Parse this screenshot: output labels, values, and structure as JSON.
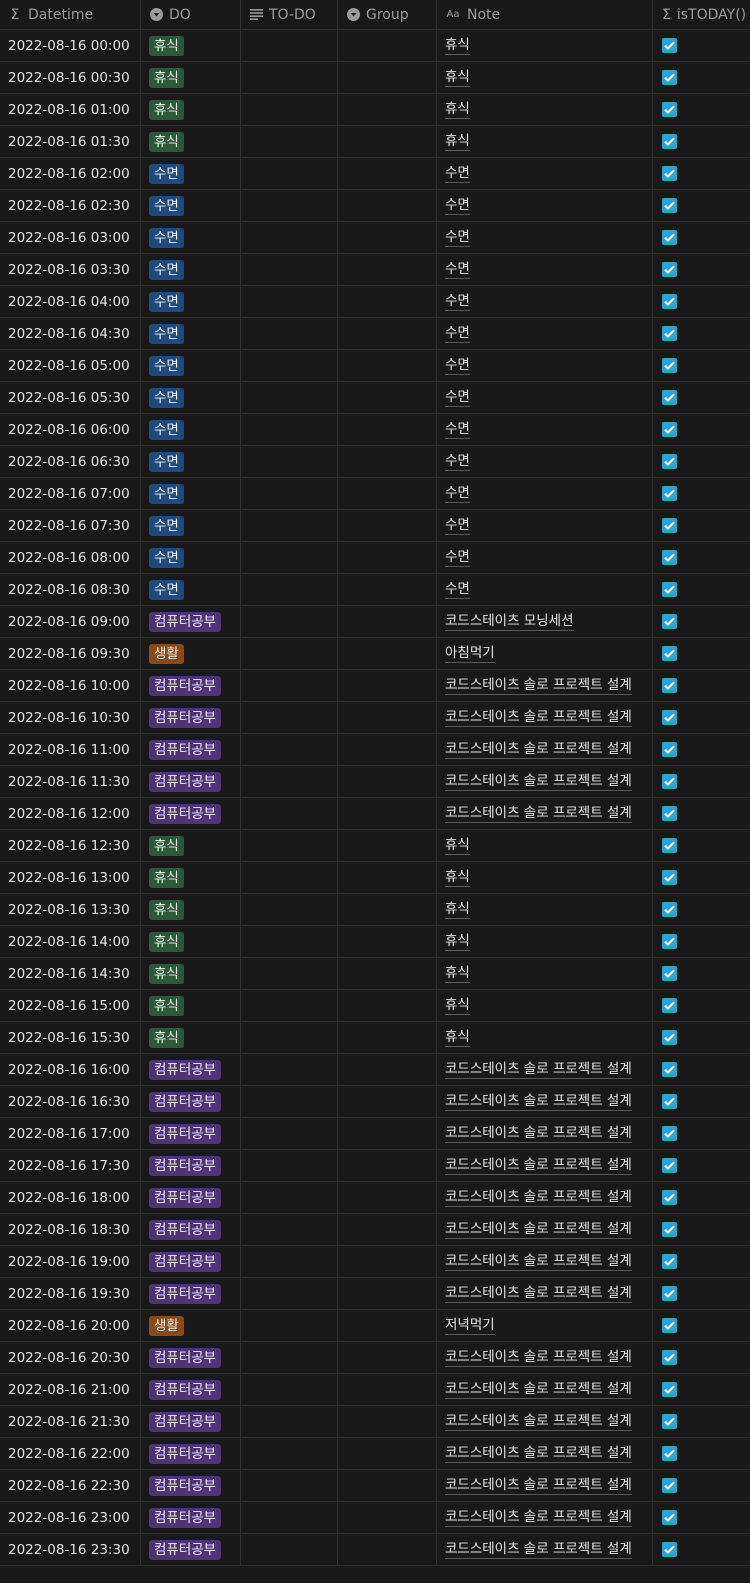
{
  "colors": {
    "background": "#191919",
    "tag_rest": "#2b5a3a",
    "tag_sleep": "#1f4a80",
    "tag_study": "#4e3377",
    "tag_life": "#8c4a16",
    "checkbox": "#2ea3d6"
  },
  "header": {
    "columns": [
      {
        "label": "Datetime",
        "icon": "sigma-icon"
      },
      {
        "label": "DO",
        "icon": "select-icon"
      },
      {
        "label": "TO-DO",
        "icon": "text-icon"
      },
      {
        "label": "Group",
        "icon": "select-icon"
      },
      {
        "label": "Note",
        "icon": "title-icon"
      },
      {
        "label": "isTODAY()",
        "icon": "sigma-icon"
      }
    ]
  },
  "rows": [
    {
      "datetime": "2022-08-16 00:00",
      "do": "휴식",
      "note": "휴식",
      "checked": true
    },
    {
      "datetime": "2022-08-16 00:30",
      "do": "휴식",
      "note": "휴식",
      "checked": true
    },
    {
      "datetime": "2022-08-16 01:00",
      "do": "휴식",
      "note": "휴식",
      "checked": true
    },
    {
      "datetime": "2022-08-16 01:30",
      "do": "휴식",
      "note": "휴식",
      "checked": true
    },
    {
      "datetime": "2022-08-16 02:00",
      "do": "수면",
      "note": "수면",
      "checked": true
    },
    {
      "datetime": "2022-08-16 02:30",
      "do": "수면",
      "note": "수면",
      "checked": true
    },
    {
      "datetime": "2022-08-16 03:00",
      "do": "수면",
      "note": "수면",
      "checked": true
    },
    {
      "datetime": "2022-08-16 03:30",
      "do": "수면",
      "note": "수면",
      "checked": true
    },
    {
      "datetime": "2022-08-16 04:00",
      "do": "수면",
      "note": "수면",
      "checked": true
    },
    {
      "datetime": "2022-08-16 04:30",
      "do": "수면",
      "note": "수면",
      "checked": true
    },
    {
      "datetime": "2022-08-16 05:00",
      "do": "수면",
      "note": "수면",
      "checked": true
    },
    {
      "datetime": "2022-08-16 05:30",
      "do": "수면",
      "note": "수면",
      "checked": true
    },
    {
      "datetime": "2022-08-16 06:00",
      "do": "수면",
      "note": "수면",
      "checked": true
    },
    {
      "datetime": "2022-08-16 06:30",
      "do": "수면",
      "note": "수면",
      "checked": true
    },
    {
      "datetime": "2022-08-16 07:00",
      "do": "수면",
      "note": "수면",
      "checked": true
    },
    {
      "datetime": "2022-08-16 07:30",
      "do": "수면",
      "note": "수면",
      "checked": true
    },
    {
      "datetime": "2022-08-16 08:00",
      "do": "수면",
      "note": "수면",
      "checked": true
    },
    {
      "datetime": "2022-08-16 08:30",
      "do": "수면",
      "note": "수면",
      "checked": true
    },
    {
      "datetime": "2022-08-16 09:00",
      "do": "컴퓨터공부",
      "note": "코드스테이츠 모닝세션",
      "checked": true
    },
    {
      "datetime": "2022-08-16 09:30",
      "do": "생활",
      "note": "아침먹기",
      "checked": true
    },
    {
      "datetime": "2022-08-16 10:00",
      "do": "컴퓨터공부",
      "note": "코드스테이츠 솔로 프로젝트 설계",
      "checked": true
    },
    {
      "datetime": "2022-08-16 10:30",
      "do": "컴퓨터공부",
      "note": "코드스테이츠 솔로 프로젝트 설계",
      "checked": true
    },
    {
      "datetime": "2022-08-16 11:00",
      "do": "컴퓨터공부",
      "note": "코드스테이츠 솔로 프로젝트 설계",
      "checked": true
    },
    {
      "datetime": "2022-08-16 11:30",
      "do": "컴퓨터공부",
      "note": "코드스테이츠 솔로 프로젝트 설계",
      "checked": true
    },
    {
      "datetime": "2022-08-16 12:00",
      "do": "컴퓨터공부",
      "note": "코드스테이츠 솔로 프로젝트 설계",
      "checked": true
    },
    {
      "datetime": "2022-08-16 12:30",
      "do": "휴식",
      "note": "휴식",
      "checked": true
    },
    {
      "datetime": "2022-08-16 13:00",
      "do": "휴식",
      "note": "휴식",
      "checked": true
    },
    {
      "datetime": "2022-08-16 13:30",
      "do": "휴식",
      "note": "휴식",
      "checked": true
    },
    {
      "datetime": "2022-08-16 14:00",
      "do": "휴식",
      "note": "휴식",
      "checked": true
    },
    {
      "datetime": "2022-08-16 14:30",
      "do": "휴식",
      "note": "휴식",
      "checked": true
    },
    {
      "datetime": "2022-08-16 15:00",
      "do": "휴식",
      "note": "휴식",
      "checked": true
    },
    {
      "datetime": "2022-08-16 15:30",
      "do": "휴식",
      "note": "휴식",
      "checked": true
    },
    {
      "datetime": "2022-08-16 16:00",
      "do": "컴퓨터공부",
      "note": "코드스테이츠 솔로 프로젝트 설계",
      "checked": true
    },
    {
      "datetime": "2022-08-16 16:30",
      "do": "컴퓨터공부",
      "note": "코드스테이츠 솔로 프로젝트 설계",
      "checked": true
    },
    {
      "datetime": "2022-08-16 17:00",
      "do": "컴퓨터공부",
      "note": "코드스테이츠 솔로 프로젝트 설계",
      "checked": true
    },
    {
      "datetime": "2022-08-16 17:30",
      "do": "컴퓨터공부",
      "note": "코드스테이츠 솔로 프로젝트 설계",
      "checked": true
    },
    {
      "datetime": "2022-08-16 18:00",
      "do": "컴퓨터공부",
      "note": "코드스테이츠 솔로 프로젝트 설계",
      "checked": true
    },
    {
      "datetime": "2022-08-16 18:30",
      "do": "컴퓨터공부",
      "note": "코드스테이츠 솔로 프로젝트 설계",
      "checked": true
    },
    {
      "datetime": "2022-08-16 19:00",
      "do": "컴퓨터공부",
      "note": "코드스테이츠 솔로 프로젝트 설계",
      "checked": true
    },
    {
      "datetime": "2022-08-16 19:30",
      "do": "컴퓨터공부",
      "note": "코드스테이츠 솔로 프로젝트 설계",
      "checked": true
    },
    {
      "datetime": "2022-08-16 20:00",
      "do": "생활",
      "note": "저녁먹기",
      "checked": true
    },
    {
      "datetime": "2022-08-16 20:30",
      "do": "컴퓨터공부",
      "note": "코드스테이츠 솔로 프로젝트 설계",
      "checked": true
    },
    {
      "datetime": "2022-08-16 21:00",
      "do": "컴퓨터공부",
      "note": "코드스테이츠 솔로 프로젝트 설계",
      "checked": true
    },
    {
      "datetime": "2022-08-16 21:30",
      "do": "컴퓨터공부",
      "note": "코드스테이츠 솔로 프로젝트 설계",
      "checked": true
    },
    {
      "datetime": "2022-08-16 22:00",
      "do": "컴퓨터공부",
      "note": "코드스테이츠 솔로 프로젝트 설계",
      "checked": true
    },
    {
      "datetime": "2022-08-16 22:30",
      "do": "컴퓨터공부",
      "note": "코드스테이츠 솔로 프로젝트 설계",
      "checked": true
    },
    {
      "datetime": "2022-08-16 23:00",
      "do": "컴퓨터공부",
      "note": "코드스테이츠 솔로 프로젝트 설계",
      "checked": true
    },
    {
      "datetime": "2022-08-16 23:30",
      "do": "컴퓨터공부",
      "note": "코드스테이츠 솔로 프로젝트 설계",
      "checked": true
    }
  ]
}
